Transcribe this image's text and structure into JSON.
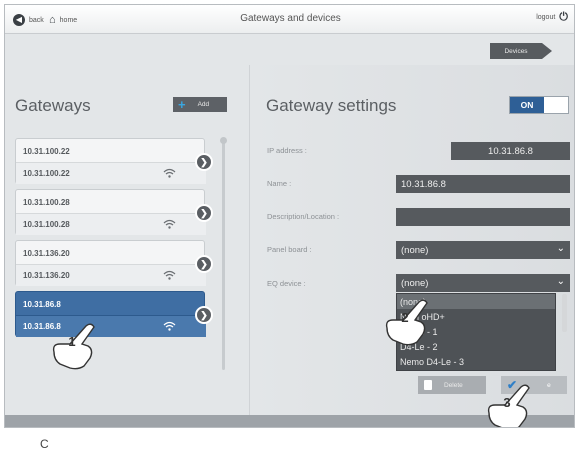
{
  "topbar": {
    "back_label": "back",
    "home_label": "home",
    "title": "Gateways and devices",
    "logout_label": "logout"
  },
  "devices_button": "Devices",
  "left": {
    "title": "Gateways",
    "add_label": "Add",
    "gateways": [
      {
        "ip": "10.31.100.22",
        "name": "10.31.100.22"
      },
      {
        "ip": "10.31.100.28",
        "name": "10.31.100.28"
      },
      {
        "ip": "10.31.136.20",
        "name": "10.31.136.20"
      },
      {
        "ip": "10.31.86.8",
        "name": "10.31.86.8",
        "selected": true
      }
    ]
  },
  "settings": {
    "title": "Gateway settings",
    "toggle": "ON",
    "labels": {
      "ip": "IP address :",
      "name": "Name :",
      "description": "Description/Location :",
      "panel": "Panel board :",
      "eq": "EQ device :"
    },
    "values": {
      "ip": "10.31.86.8",
      "name": "10.31.86.8",
      "description": "",
      "panel": "(none)",
      "eq": "(none)"
    },
    "eq_options": [
      "(none)",
      "Nem   oHD+",
      "     D4-Le - 1",
      "     D4-Le - 2",
      "Nemo D4-Le - 3"
    ],
    "delete_label": "Delete",
    "save_label": "e"
  },
  "markers": [
    "1",
    "2",
    "3"
  ],
  "stray_char": "C",
  "colors": {
    "accent_blue": "#2e5f96",
    "selected_card": "#3f6ea3",
    "dark_field": "#565a5e",
    "plus_blue": "#3aa6e0"
  },
  "icons": {
    "back": "back-arrow-icon",
    "home": "home-icon",
    "logout": "power-icon",
    "wifi": "wifi-icon",
    "chevron": "chevron-right-icon",
    "dropdown": "chevron-down-icon",
    "trash": "trash-icon",
    "check": "check-icon",
    "hand": "pointing-hand-icon"
  }
}
